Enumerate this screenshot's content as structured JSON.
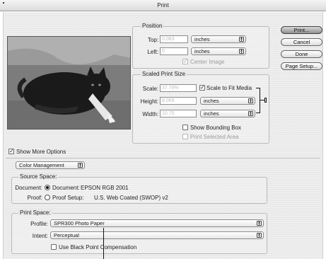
{
  "window": {
    "title": "Print"
  },
  "position": {
    "legend": "Position",
    "top_label": "Top:",
    "top_value": "0.083",
    "top_unit": "inches",
    "left_label": "Left:",
    "left_value": "0",
    "left_unit": "inches",
    "center_image_label": "Center Image",
    "center_image_checked": true
  },
  "scaled": {
    "legend": "Scaled Print Size",
    "scale_label": "Scale:",
    "scale_value": "37.79%",
    "fit_media_label": "Scale to Fit Media",
    "fit_media_checked": true,
    "height_label": "Height:",
    "height_value": "8.069",
    "height_unit": "inches",
    "width_label": "Width:",
    "width_value": "10.75",
    "width_unit": "inches",
    "bounding_box_label": "Show Bounding Box",
    "selected_area_label": "Print Selected Area"
  },
  "buttons": {
    "print": "Print...",
    "cancel": "Cancel",
    "done": "Done",
    "page_setup": "Page Setup..."
  },
  "options": {
    "show_more_label": "Show More Options",
    "show_more_checked": true,
    "mode_value": "Color Management"
  },
  "source": {
    "legend": "Source Space:",
    "document_label": "Document:",
    "document_option": "Document:",
    "document_profile": "EPSON RGB 2001",
    "proof_label": "Proof:",
    "proof_option": "Proof Setup:",
    "proof_profile": "U.S. Web Coated (SWOP) v2"
  },
  "print_space": {
    "legend": "Print Space:",
    "profile_label": "Profile:",
    "profile_value": "SPR300 Photo Paper",
    "intent_label": "Intent:",
    "intent_value": "Perceptual",
    "black_point_label": "Use Black Point Compensation"
  },
  "icons": {
    "stepper": "popup-stepper-icon",
    "check": "checkmark-icon",
    "link": "link-bracket-icon"
  },
  "colors": {
    "dialog_bg": "#e9e9e9",
    "default_button": "#8f8f8f",
    "disabled_text": "#9c9c9c"
  }
}
